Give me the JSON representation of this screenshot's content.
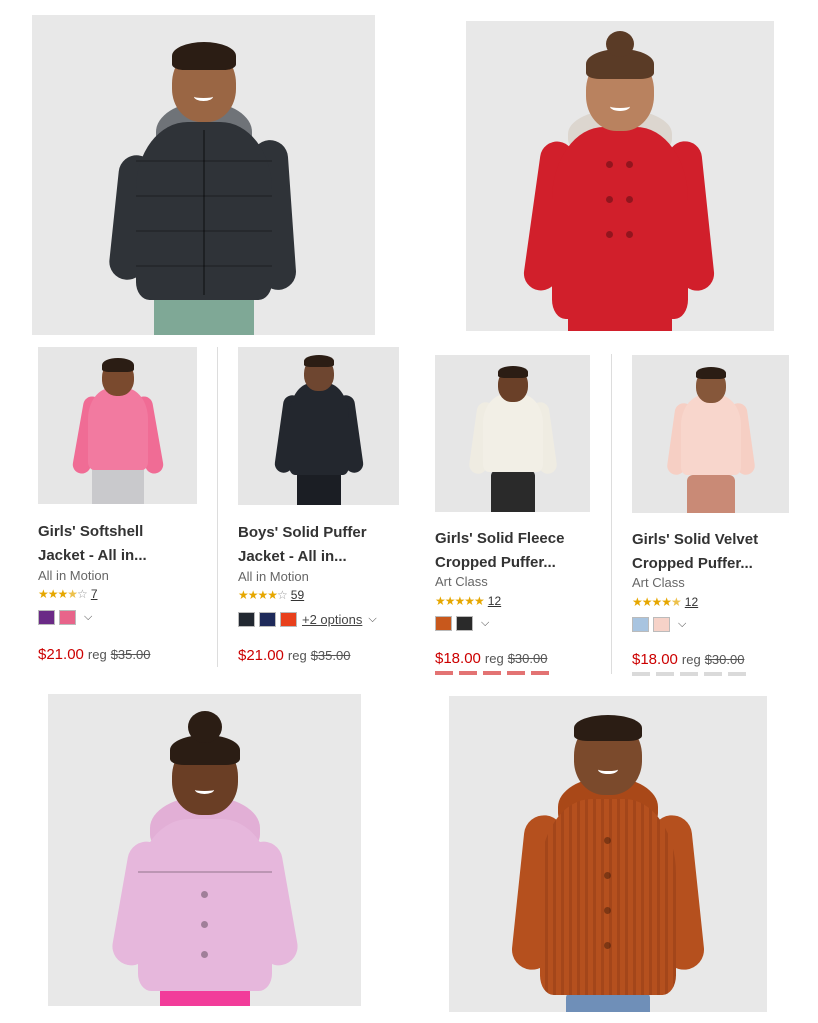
{
  "products": [
    {
      "title_line1": "Girls' Softshell",
      "title_line2": "Jacket - All in...",
      "brand": "All in Motion",
      "stars": 3.5,
      "review_count": "7",
      "swatches": [
        "#6a2a86",
        "#e8648a"
      ],
      "options_text": "",
      "price": "$21.00",
      "reg_label": "reg",
      "reg_price": "$35.00"
    },
    {
      "title_line1": "Boys' Solid Puffer",
      "title_line2": "Jacket - All in...",
      "brand": "All in Motion",
      "stars": 4,
      "review_count": "59",
      "swatches": [
        "#222831",
        "#1e2a5a",
        "#e8401c"
      ],
      "options_text": "+2 options",
      "price": "$21.00",
      "reg_label": "reg",
      "reg_price": "$35.00"
    },
    {
      "title_line1": "Girls' Solid Fleece",
      "title_line2": "Cropped Puffer...",
      "brand": "Art Class",
      "stars": 5,
      "review_count": "12",
      "swatches": [
        "#c8581c",
        "#2a2a2a"
      ],
      "options_text": "",
      "price": "$18.00",
      "reg_label": "reg",
      "reg_price": "$30.00"
    },
    {
      "title_line1": "Girls' Solid Velvet",
      "title_line2": "Cropped Puffer...",
      "brand": "Art Class",
      "stars": 4.5,
      "review_count": "12",
      "swatches": [
        "#a8c4e0",
        "#f6d2c8"
      ],
      "options_text": "",
      "price": "$18.00",
      "reg_label": "reg",
      "reg_price": "$30.00"
    }
  ],
  "colors": {
    "sale_price": "#cc0000",
    "star": "#e6a700",
    "photo_bg": "#e8e8e8"
  },
  "photos": [
    {
      "subject": "boy-black-puffer-jacket",
      "coat_color": "#2f3338"
    },
    {
      "subject": "girl-red-wool-coat",
      "coat_color": "#d11f2b"
    },
    {
      "subject": "toddler-girl-pink-puffer",
      "coat_color": "#e6b7dc"
    },
    {
      "subject": "toddler-boy-rust-corduroy-jacket",
      "coat_color": "#b5501e"
    }
  ]
}
